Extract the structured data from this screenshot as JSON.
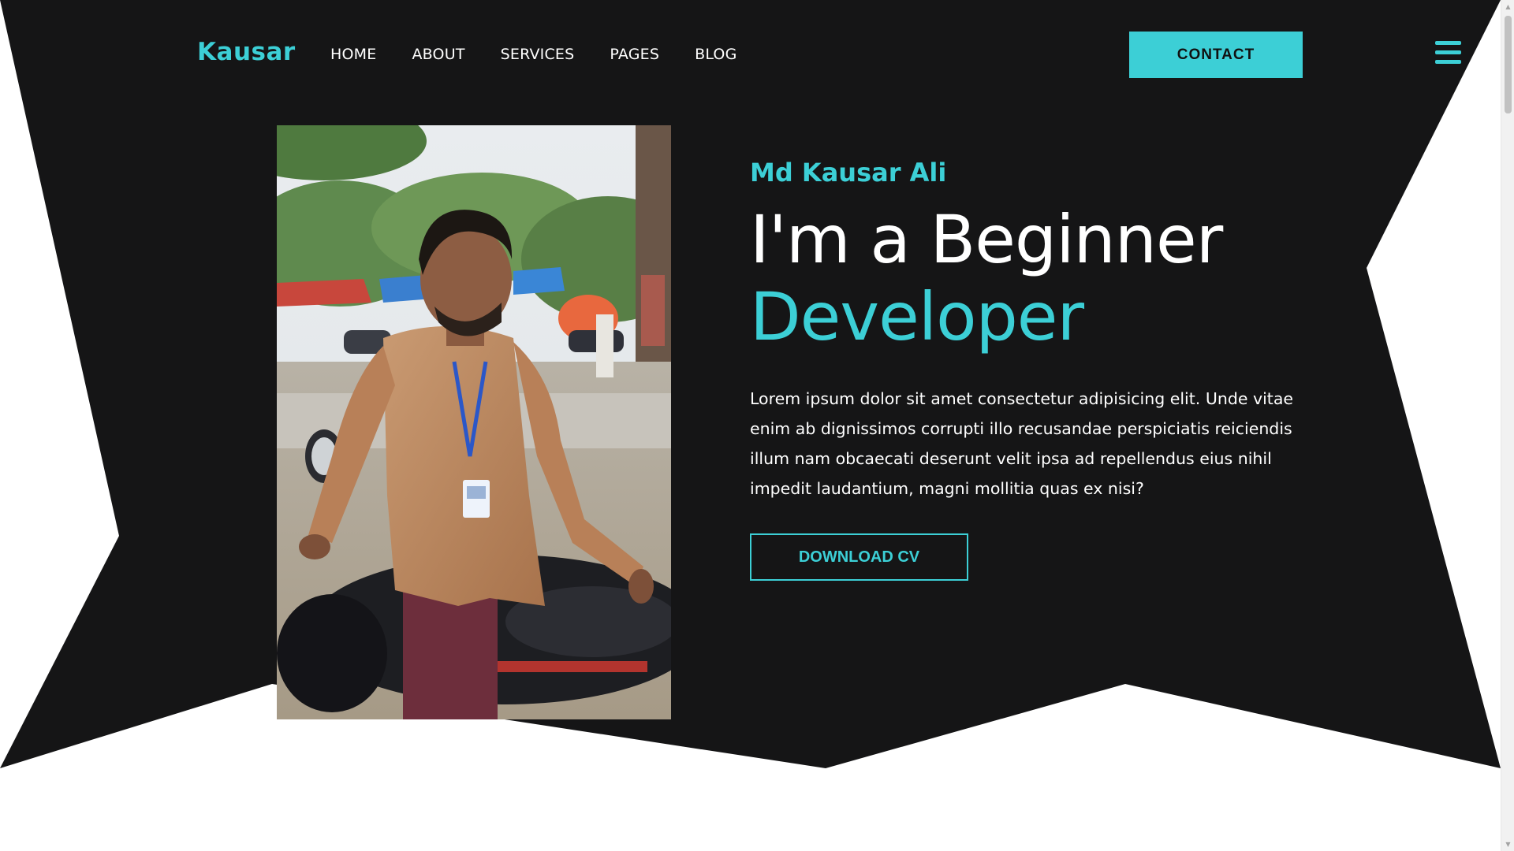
{
  "brand": {
    "logo": "Kausar"
  },
  "nav": {
    "items": [
      {
        "label": "HOME"
      },
      {
        "label": "ABOUT"
      },
      {
        "label": "SERVICES"
      },
      {
        "label": "PAGES"
      },
      {
        "label": "BLOG"
      }
    ],
    "contact_label": "CONTACT",
    "menu_icon": "hamburger-icon"
  },
  "hero": {
    "name": "Md Kausar Ali",
    "heading_line1": "I'm a Beginner",
    "heading_line2": "Developer",
    "description": "Lorem ipsum dolor sit amet consectetur adipisicing elit. Unde vitae enim ab dignissimos corrupti illo recusandae perspiciatis reiciendis illum nam obcaecati deserunt velit ipsa ad repellendus eius nihil impedit laudantium, magni mollitia quas ex nisi?",
    "cta_label": "DOWNLOAD CV"
  },
  "colors": {
    "accent": "#3ccfd6",
    "background": "#151516",
    "text": "#ffffff"
  }
}
